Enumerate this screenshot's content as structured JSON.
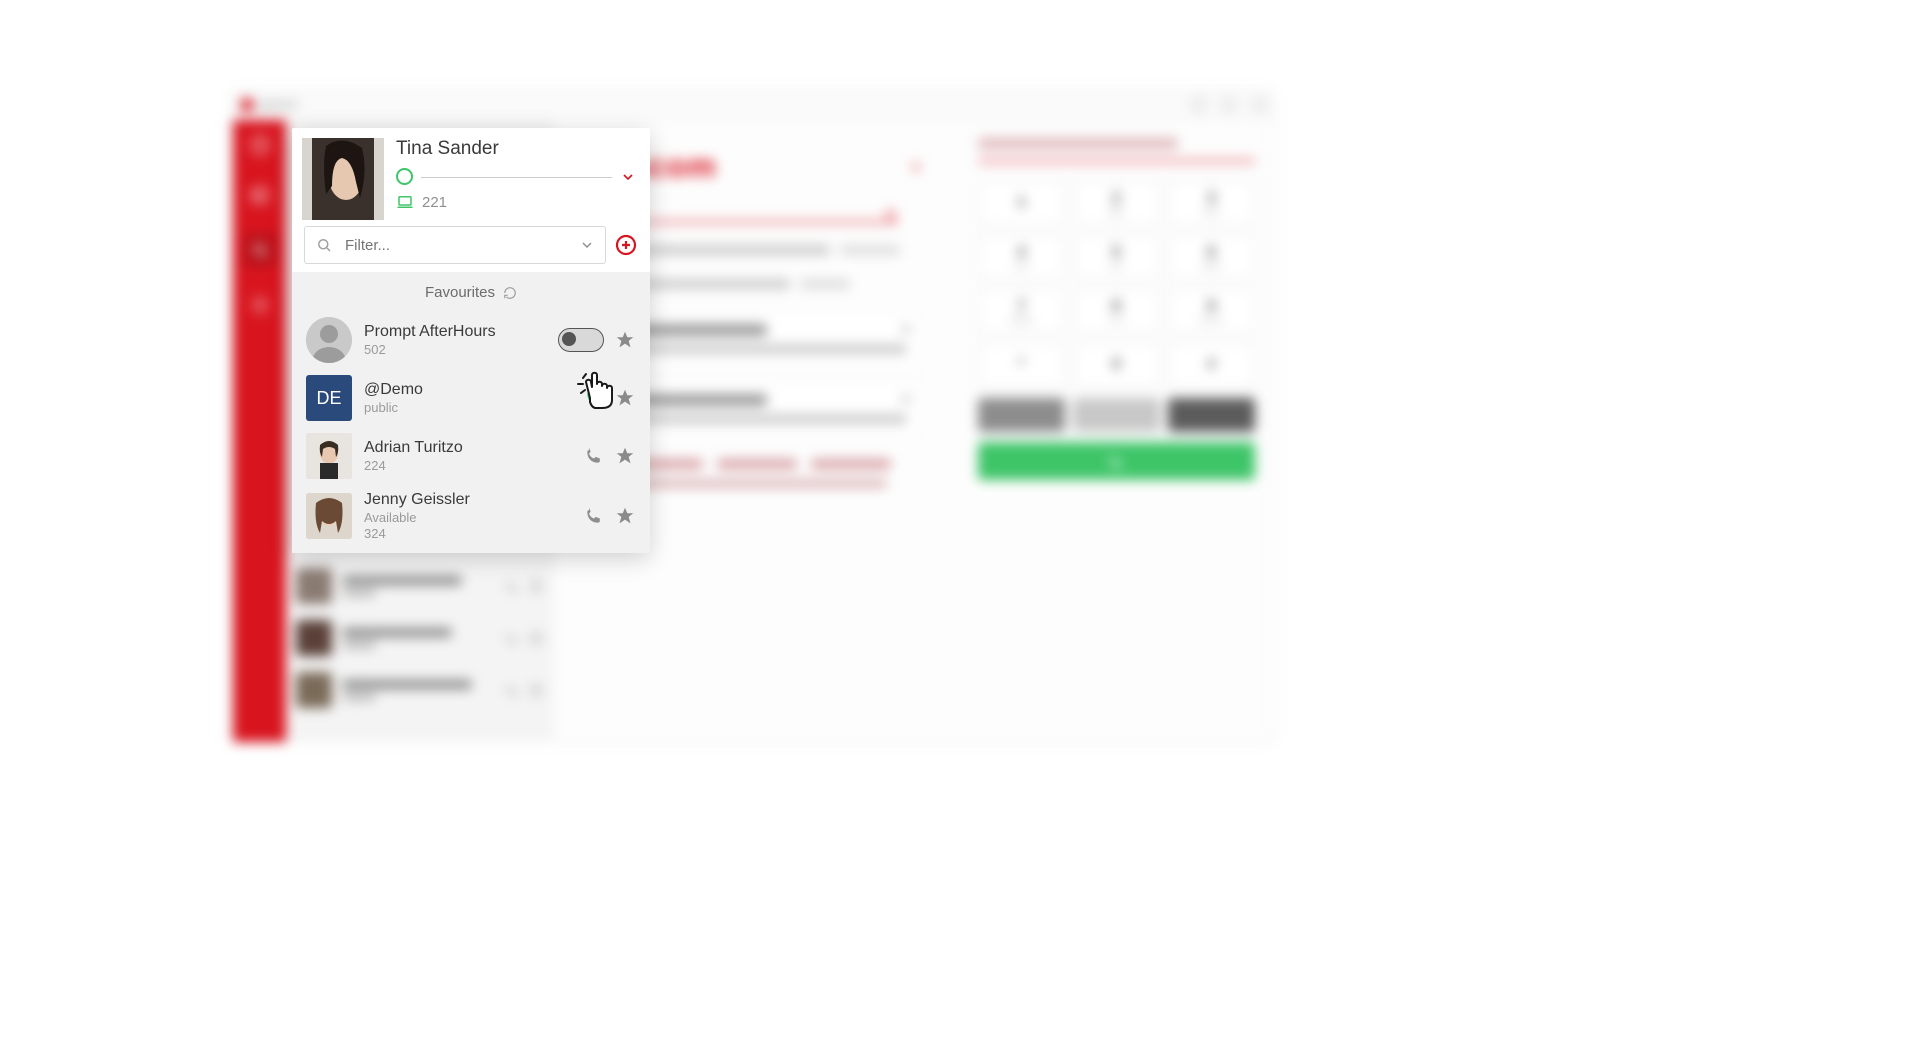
{
  "window": {
    "title": "pascom"
  },
  "brand": "pascom",
  "me": {
    "name": "Tina Sander",
    "extension": "221"
  },
  "filter": {
    "placeholder": "Filter..."
  },
  "favourites_label": "Favourites",
  "contacts": [
    {
      "name": "Prompt AfterHours",
      "sub": "502",
      "avatar": "silhouette",
      "toggle": true,
      "phone": null,
      "star": true
    },
    {
      "name": "@Demo",
      "sub": "public",
      "avatar": "DE",
      "toggle": false,
      "phone": "green",
      "star": true
    },
    {
      "name": "Adrian Turitzo",
      "sub": "224",
      "avatar": "face1",
      "toggle": false,
      "phone": "grey",
      "star": true
    },
    {
      "name": "Jenny Geissler",
      "sub": "Available",
      "sub2": "324",
      "avatar": "face2",
      "toggle": false,
      "phone": "grey",
      "star": true
    }
  ],
  "dialpad": {
    "placeholder": "Nummer eingeben oder suchen",
    "keys": [
      {
        "n": "1",
        "l": ""
      },
      {
        "n": "2",
        "l": "ABC"
      },
      {
        "n": "3",
        "l": "DEF"
      },
      {
        "n": "4",
        "l": "GHI"
      },
      {
        "n": "5",
        "l": "JKL"
      },
      {
        "n": "6",
        "l": "MNO"
      },
      {
        "n": "7",
        "l": "PQRS"
      },
      {
        "n": "8",
        "l": "TUV"
      },
      {
        "n": "9",
        "l": "WXYZ"
      },
      {
        "n": "*",
        "l": ""
      },
      {
        "n": "0",
        "l": ""
      },
      {
        "n": "#",
        "l": ""
      }
    ]
  }
}
